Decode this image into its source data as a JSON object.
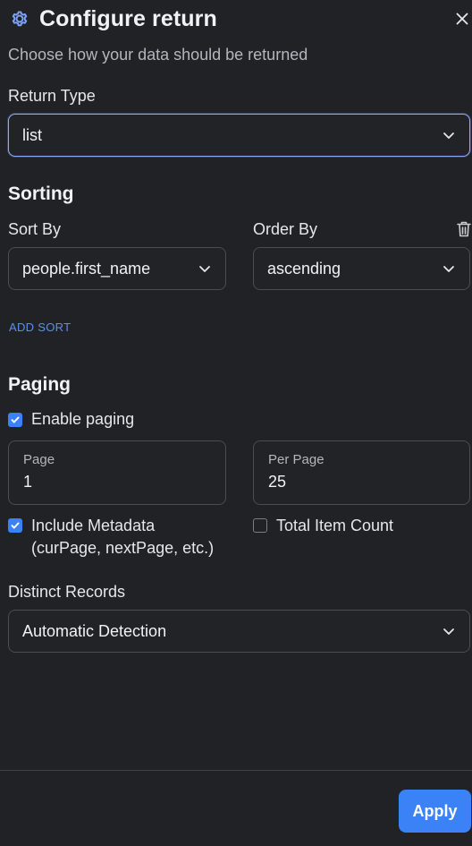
{
  "header": {
    "title": "Configure return",
    "subtitle": "Choose how your data should be returned"
  },
  "return_type": {
    "label": "Return Type",
    "value": "list"
  },
  "sorting": {
    "section_title": "Sorting",
    "sort_by_label": "Sort By",
    "sort_by_value": "people.first_name",
    "order_by_label": "Order By",
    "order_by_value": "ascending",
    "add_sort_label": "ADD SORT"
  },
  "paging": {
    "section_title": "Paging",
    "enable_paging_label": "Enable paging",
    "enable_paging_checked": true,
    "page_label": "Page",
    "page_value": "1",
    "per_page_label": "Per Page",
    "per_page_value": "25",
    "include_metadata_label_line1": "Include Metadata",
    "include_metadata_label_line2": "(curPage, nextPage, etc.)",
    "include_metadata_checked": true,
    "total_item_count_label": "Total Item Count",
    "total_item_count_checked": false
  },
  "distinct": {
    "label": "Distinct Records",
    "value": "Automatic Detection"
  },
  "footer": {
    "apply_label": "Apply"
  },
  "colors": {
    "background": "#202226",
    "accent": "#3b82f6",
    "link": "#5b8ff0",
    "focus_border": "#8fa8ff"
  },
  "icons": [
    "gear-icon",
    "close-icon",
    "chevron-down-icon",
    "trash-icon",
    "checkmark-icon"
  ]
}
